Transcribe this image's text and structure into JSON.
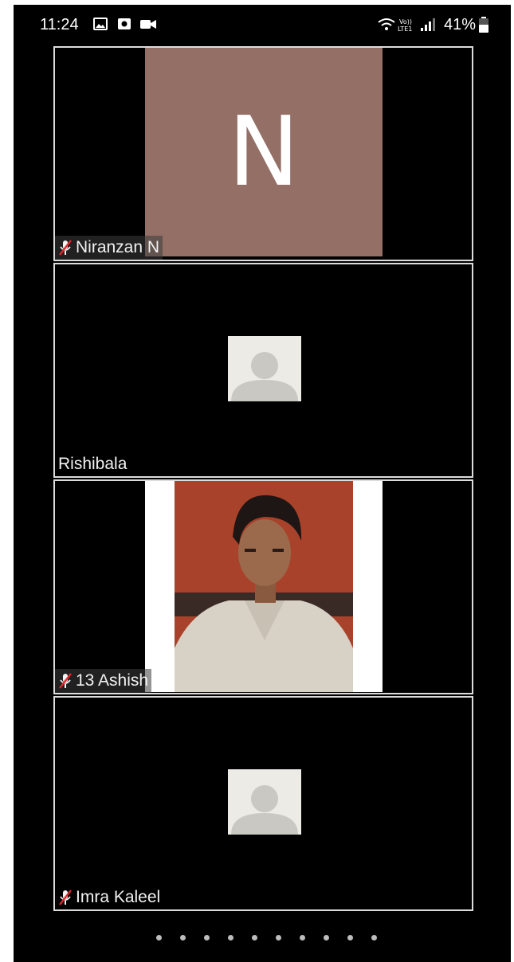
{
  "status_bar": {
    "time": "11:24",
    "battery": "41%",
    "icons": [
      "image-icon",
      "record-icon",
      "video-icon",
      "wifi-icon",
      "volte-icon",
      "signal-icon",
      "battery-icon"
    ]
  },
  "participants": [
    {
      "name": "Niranzan N",
      "muted": true,
      "display": "initial",
      "initial": "N",
      "avatar_color": "#936f66"
    },
    {
      "name": "Rishibala",
      "muted": false,
      "display": "avatar"
    },
    {
      "name": "13 Ashish",
      "muted": true,
      "display": "video"
    },
    {
      "name": "Imra Kaleel",
      "muted": true,
      "display": "avatar"
    }
  ],
  "pagination": {
    "page_count": 10,
    "current": 1
  }
}
